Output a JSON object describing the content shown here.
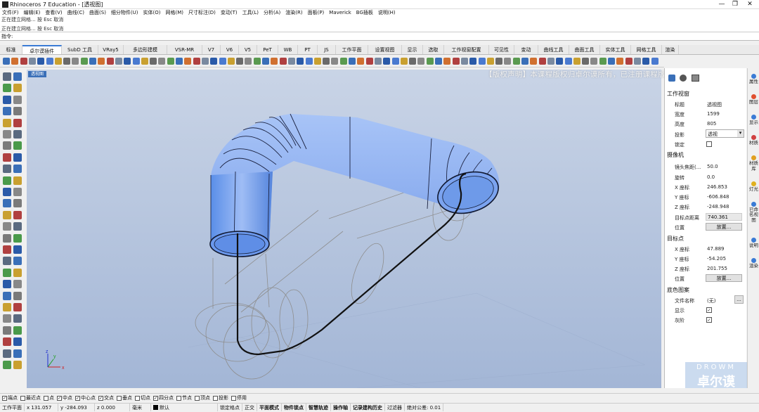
{
  "title": "Rhinoceros 7 Education - [透视图]",
  "menu": [
    "文件(F)",
    "编辑(E)",
    "查看(V)",
    "曲线(C)",
    "曲面(S)",
    "细分物件(U)",
    "实体(O)",
    "网格(M)",
    "尺寸标注(D)",
    "变动(T)",
    "工具(L)",
    "分析(A)",
    "渲染(R)",
    "面板(P)",
    "Maverick",
    "BG插板",
    "说明(H)"
  ],
  "command_history": [
    "正在建立网格... 按 Esc 取消",
    "正在建立网格... 按 Esc 取消"
  ],
  "command_prompt": "指令:",
  "tabs": [
    "标准",
    "卓尔谟插件",
    "SubD 工具",
    "VRay5",
    "多边形建模",
    "VSR-MR",
    "V7",
    "V6",
    "V5",
    "PeT",
    "WB",
    "PT",
    "JS",
    "工作平面",
    "设置视图",
    "显示",
    "选取",
    "工作视窗配置",
    "可见性",
    "变动",
    "曲线工具",
    "曲面工具",
    "实体工具",
    "网格工具",
    "渲染"
  ],
  "active_tab": 1,
  "viewport": {
    "label": "透视图",
    "axis_x": "x",
    "axis_y": "y",
    "axis_z": "z"
  },
  "notice": "【版权声明】本课程版权归卓尔谟所有，已注册课程版权专利，盗版必究!",
  "properties": {
    "sec_viewport": "工作视窗",
    "title_label": "标题",
    "title_value": "透视图",
    "width_label": "宽度",
    "width_value": "1599",
    "height_label": "高度",
    "height_value": "805",
    "proj_label": "投影",
    "proj_value": "透视",
    "lock_label": "锁定",
    "sec_camera": "摄像机",
    "lens_label": "镜头焦距(...",
    "lens_value": "50.0",
    "rot_label": "旋转",
    "rot_value": "0.0",
    "cx_label": "X 座标",
    "cx_value": "246.853",
    "cy_label": "Y 座标",
    "cy_value": "-606.848",
    "cz_label": "Z 座标",
    "cz_value": "-248.948",
    "dist_label": "目标点距离",
    "dist_value": "740.361",
    "pos_label": "位置",
    "place_btn": "放置...",
    "sec_target": "目标点",
    "tx_label": "X 座标",
    "tx_value": "47.889",
    "ty_label": "Y 座标",
    "ty_value": "-54.205",
    "tz_label": "Z 座标",
    "tz_value": "201.755",
    "tpos_label": "位置",
    "tplace_btn": "放置...",
    "sec_bg": "底色图案",
    "file_label": "文件名称",
    "file_value": "(无)",
    "file_btn": "...",
    "show_label": "显示",
    "gray_label": "灰阶"
  },
  "side_tabs": [
    {
      "label": "属性",
      "color": "#3a7bd5"
    },
    {
      "label": "图层",
      "color": "#e05030"
    },
    {
      "label": "显示",
      "color": "#3a7bd5"
    },
    {
      "label": "材质",
      "color": "#d04040"
    },
    {
      "label": "材质库",
      "color": "#e0a020"
    },
    {
      "label": "灯光",
      "color": "#e0b020"
    },
    {
      "label": "已命名视图",
      "color": "#3a7bd5"
    },
    {
      "label": "说明",
      "color": "#3a7bd5"
    },
    {
      "label": "渲染",
      "color": "#3a7bd5"
    }
  ],
  "watermark": {
    "top": "DROWM",
    "bottom": "卓尔谟"
  },
  "osnaps": [
    {
      "label": "端点",
      "on": true
    },
    {
      "label": "最近点",
      "on": false
    },
    {
      "label": "点",
      "on": false
    },
    {
      "label": "中点",
      "on": true
    },
    {
      "label": "中心点",
      "on": true
    },
    {
      "label": "交点",
      "on": true
    },
    {
      "label": "垂点",
      "on": false
    },
    {
      "label": "切点",
      "on": false
    },
    {
      "label": "四分点",
      "on": true
    },
    {
      "label": "节点",
      "on": false
    },
    {
      "label": "顶点",
      "on": false
    },
    {
      "label": "投影",
      "on": false
    },
    {
      "label": "停用",
      "on": false
    }
  ],
  "status": {
    "cplane": "工作平面",
    "x": "x 131.057",
    "y": "y -284.093",
    "z": "z 0.000",
    "unit": "毫米",
    "layer": "默认",
    "items": [
      "锁定格点",
      "正交",
      "平面模式",
      "物件锁点",
      "智慧轨迹",
      "操作轴",
      "记录建构历史",
      "过滤器",
      "绝对公差: 0.01"
    ],
    "bold": [
      false,
      false,
      true,
      true,
      true,
      true,
      true,
      false,
      false
    ]
  }
}
